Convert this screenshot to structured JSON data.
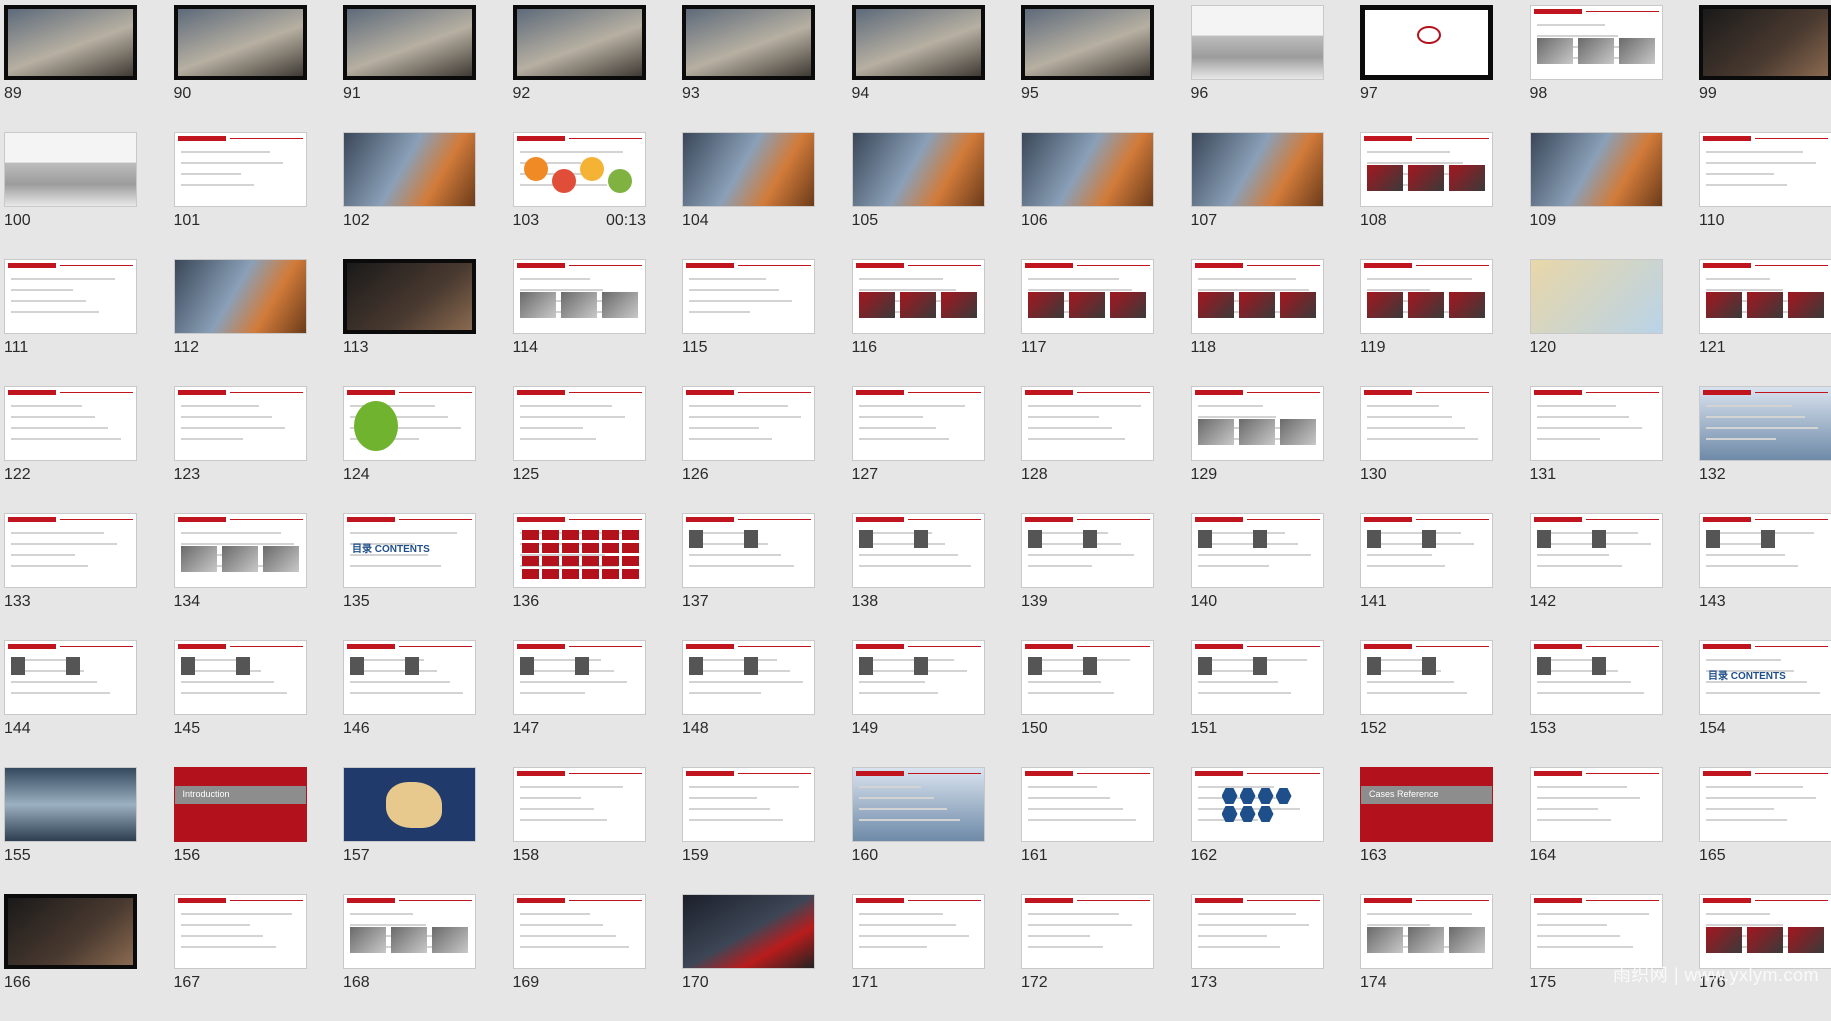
{
  "slides": [
    {
      "n": "89",
      "s": "sketch"
    },
    {
      "n": "90",
      "s": "sketch"
    },
    {
      "n": "91",
      "s": "sketch"
    },
    {
      "n": "92",
      "s": "sketch"
    },
    {
      "n": "93",
      "s": "sketch"
    },
    {
      "n": "94",
      "s": "sketch"
    },
    {
      "n": "95",
      "s": "sketch"
    },
    {
      "n": "96",
      "s": "cars"
    },
    {
      "n": "97",
      "s": "logo"
    },
    {
      "n": "98",
      "s": "collage"
    },
    {
      "n": "99",
      "s": "darkphoto"
    },
    {
      "n": "100",
      "s": "cars"
    },
    {
      "n": "101",
      "s": "text"
    },
    {
      "n": "102",
      "s": "photo"
    },
    {
      "n": "103",
      "s": "circles",
      "dur": "00:13"
    },
    {
      "n": "104",
      "s": "photo"
    },
    {
      "n": "105",
      "s": "photo"
    },
    {
      "n": "106",
      "s": "photo"
    },
    {
      "n": "107",
      "s": "photo"
    },
    {
      "n": "108",
      "s": "redtext"
    },
    {
      "n": "109",
      "s": "photo"
    },
    {
      "n": "110",
      "s": "text"
    },
    {
      "n": "111",
      "s": "text"
    },
    {
      "n": "112",
      "s": "photo"
    },
    {
      "n": "113",
      "s": "darkphoto"
    },
    {
      "n": "114",
      "s": "collage"
    },
    {
      "n": "115",
      "s": "text"
    },
    {
      "n": "116",
      "s": "redtext"
    },
    {
      "n": "117",
      "s": "redtext"
    },
    {
      "n": "118",
      "s": "redtext"
    },
    {
      "n": "119",
      "s": "redtext"
    },
    {
      "n": "120",
      "s": "map"
    },
    {
      "n": "121",
      "s": "redtext"
    },
    {
      "n": "122",
      "s": "text"
    },
    {
      "n": "123",
      "s": "text"
    },
    {
      "n": "124",
      "s": "tree"
    },
    {
      "n": "125",
      "s": "text"
    },
    {
      "n": "126",
      "s": "text"
    },
    {
      "n": "127",
      "s": "text"
    },
    {
      "n": "128",
      "s": "text"
    },
    {
      "n": "129",
      "s": "collage"
    },
    {
      "n": "130",
      "s": "text"
    },
    {
      "n": "131",
      "s": "text"
    },
    {
      "n": "132",
      "s": "blue"
    },
    {
      "n": "133",
      "s": "table"
    },
    {
      "n": "134",
      "s": "collage"
    },
    {
      "n": "135",
      "s": "contents",
      "ct": "目录 CONTENTS"
    },
    {
      "n": "136",
      "s": "redgrid"
    },
    {
      "n": "137",
      "s": "people"
    },
    {
      "n": "138",
      "s": "people"
    },
    {
      "n": "139",
      "s": "people"
    },
    {
      "n": "140",
      "s": "people"
    },
    {
      "n": "141",
      "s": "people"
    },
    {
      "n": "142",
      "s": "people"
    },
    {
      "n": "143",
      "s": "people"
    },
    {
      "n": "144",
      "s": "people"
    },
    {
      "n": "145",
      "s": "people"
    },
    {
      "n": "146",
      "s": "people"
    },
    {
      "n": "147",
      "s": "people"
    },
    {
      "n": "148",
      "s": "people"
    },
    {
      "n": "149",
      "s": "people"
    },
    {
      "n": "150",
      "s": "people"
    },
    {
      "n": "151",
      "s": "people"
    },
    {
      "n": "152",
      "s": "people"
    },
    {
      "n": "153",
      "s": "people"
    },
    {
      "n": "154",
      "s": "contents",
      "ct": "目录 CONTENTS"
    },
    {
      "n": "155",
      "s": "sky"
    },
    {
      "n": "156",
      "s": "red",
      "t": "Introduction"
    },
    {
      "n": "157",
      "s": "china"
    },
    {
      "n": "158",
      "s": "text"
    },
    {
      "n": "159",
      "s": "text"
    },
    {
      "n": "160",
      "s": "blue"
    },
    {
      "n": "161",
      "s": "text"
    },
    {
      "n": "162",
      "s": "hex"
    },
    {
      "n": "163",
      "s": "red",
      "t": "Cases Reference"
    },
    {
      "n": "164",
      "s": "text"
    },
    {
      "n": "165",
      "s": "text"
    },
    {
      "n": "166",
      "s": "darkphoto"
    },
    {
      "n": "167",
      "s": "text"
    },
    {
      "n": "168",
      "s": "collage"
    },
    {
      "n": "169",
      "s": "text"
    },
    {
      "n": "170",
      "s": "car"
    },
    {
      "n": "171",
      "s": "text"
    },
    {
      "n": "172",
      "s": "text"
    },
    {
      "n": "173",
      "s": "text"
    },
    {
      "n": "174",
      "s": "collage"
    },
    {
      "n": "175",
      "s": "text"
    },
    {
      "n": "176",
      "s": "redtext"
    }
  ],
  "watermark": "雨织网 | www.yxlym.com"
}
